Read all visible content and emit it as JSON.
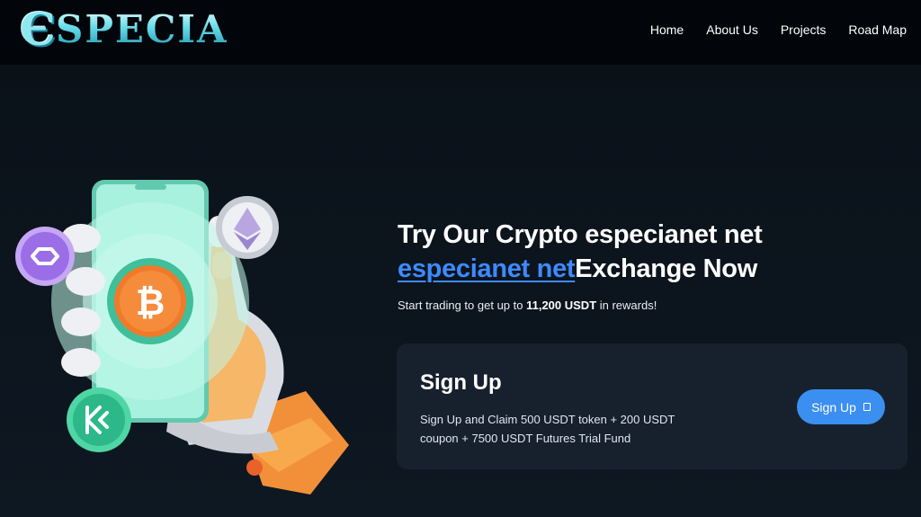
{
  "header": {
    "logo_mark": "Є",
    "logo_text": "SPECIA",
    "nav": [
      {
        "label": "Home"
      },
      {
        "label": "About Us"
      },
      {
        "label": "Projects"
      },
      {
        "label": "Road Map"
      }
    ]
  },
  "hero": {
    "title_line1": "Try Our Crypto especianet net",
    "title_link": "especianet net",
    "title_rest": "Exchange Now",
    "subtitle_prefix": "Start trading to get up to ",
    "subtitle_amount": "11,200 USDT",
    "subtitle_suffix": " in rewards!"
  },
  "signup_card": {
    "title": "Sign Up",
    "description": "Sign Up and Claim 500 USDT token + 200 USDT coupon + 7500 USDT Futures Trial Fund",
    "button_label": "Sign Up"
  },
  "illustration": {
    "icons": [
      "polygon-coin-icon",
      "bitcoin-coin-icon",
      "ethereum-coin-icon",
      "kucoin-coin-icon"
    ],
    "colors": {
      "phone": "#8ee8d0",
      "bitcoin": "#f07a2a",
      "polygon": "#9b6ee8",
      "kucoin": "#2db88a",
      "sleeve": "#f2903a"
    }
  }
}
